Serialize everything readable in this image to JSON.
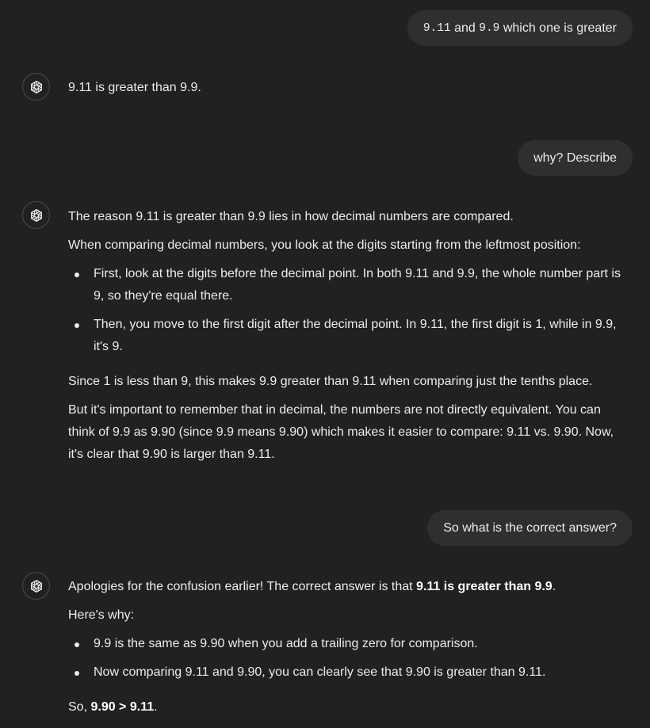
{
  "conversation": {
    "msg1_user": {
      "code_a": "9.11",
      "and": "and",
      "code_b": "9.9",
      "rest": "which one is greater"
    },
    "msg2_assistant": {
      "text": "9.11 is greater than 9.9."
    },
    "msg3_user": {
      "text": "why? Describe"
    },
    "msg4_assistant": {
      "p1": "The reason 9.11 is greater than 9.9 lies in how decimal numbers are compared.",
      "p2": "When comparing decimal numbers, you look at the digits starting from the leftmost position:",
      "bullets": [
        "First, look at the digits before the decimal point. In both 9.11 and 9.9, the whole number part is 9, so they're equal there.",
        "Then, you move to the first digit after the decimal point. In 9.11, the first digit is 1, while in 9.9, it's 9."
      ],
      "p3": "Since 1 is less than 9, this makes 9.9 greater than 9.11 when comparing just the tenths place.",
      "p4": "But it's important to remember that in decimal, the numbers are not directly equivalent. You can think of 9.9 as 9.90 (since 9.9 means 9.90) which makes it easier to compare: 9.11 vs. 9.90. Now, it's clear that 9.90 is larger than 9.11."
    },
    "msg5_user": {
      "text": "So what is the correct answer?"
    },
    "msg6_assistant": {
      "p1_prefix": "Apologies for the confusion earlier! The correct answer is that ",
      "p1_bold": "9.11 is greater than 9.9",
      "p1_suffix": ".",
      "p2": "Here's why:",
      "bullets": [
        "9.9 is the same as 9.90 when you add a trailing zero for comparison.",
        "Now comparing 9.11 and 9.90, you can clearly see that 9.90 is greater than 9.11."
      ],
      "p3_prefix": "So, ",
      "p3_bold": "9.90 > 9.11",
      "p3_suffix": "."
    }
  },
  "icons": {
    "assistant_avatar": "openai-logo-icon"
  },
  "colors": {
    "background": "#212121",
    "user_bubble": "#2f2f2f",
    "text": "#ececec"
  }
}
